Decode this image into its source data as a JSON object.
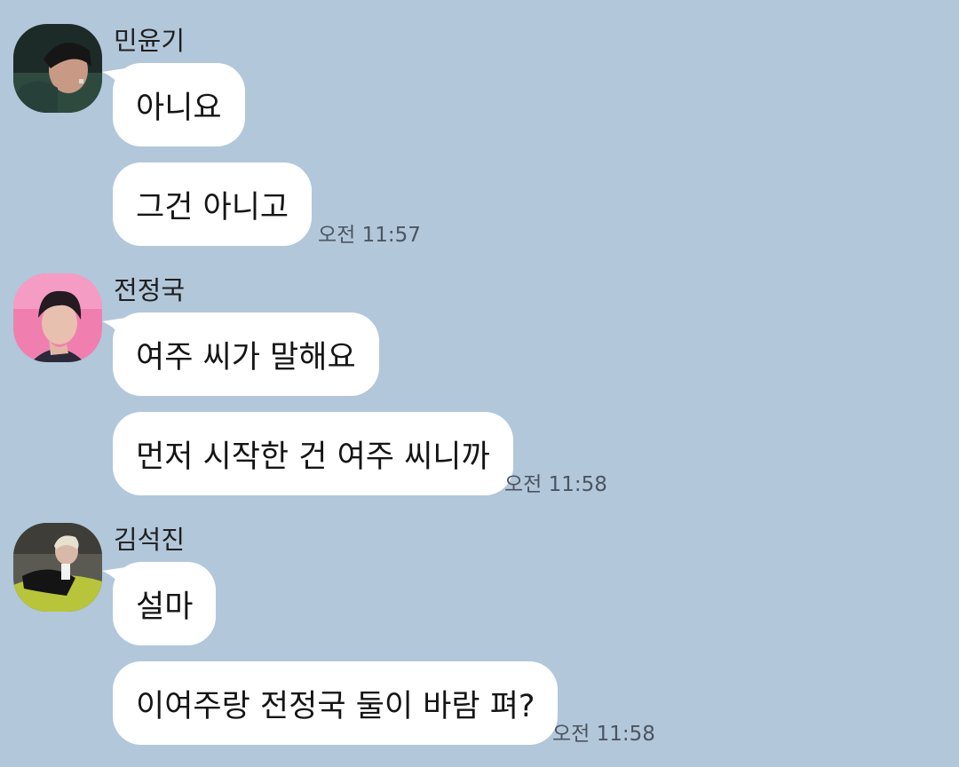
{
  "messages": [
    {
      "sender": "민윤기",
      "avatar_icon": "profile-photo-icon",
      "bubbles": [
        "아니요",
        "그건 아니고"
      ],
      "time": "오전 11:57"
    },
    {
      "sender": "전정국",
      "avatar_icon": "profile-photo-icon",
      "bubbles": [
        "여주 씨가 말해요",
        "먼저 시작한 건 여주 씨니까"
      ],
      "time": "오전 11:58"
    },
    {
      "sender": "김석진",
      "avatar_icon": "profile-photo-icon",
      "bubbles": [
        "설마",
        "이여주랑 전정국 둘이 바람 펴?"
      ],
      "time": "오전 11:58"
    }
  ],
  "colors": {
    "background": "#b2c7da",
    "bubble": "#ffffff",
    "time_text": "#4b5560"
  }
}
